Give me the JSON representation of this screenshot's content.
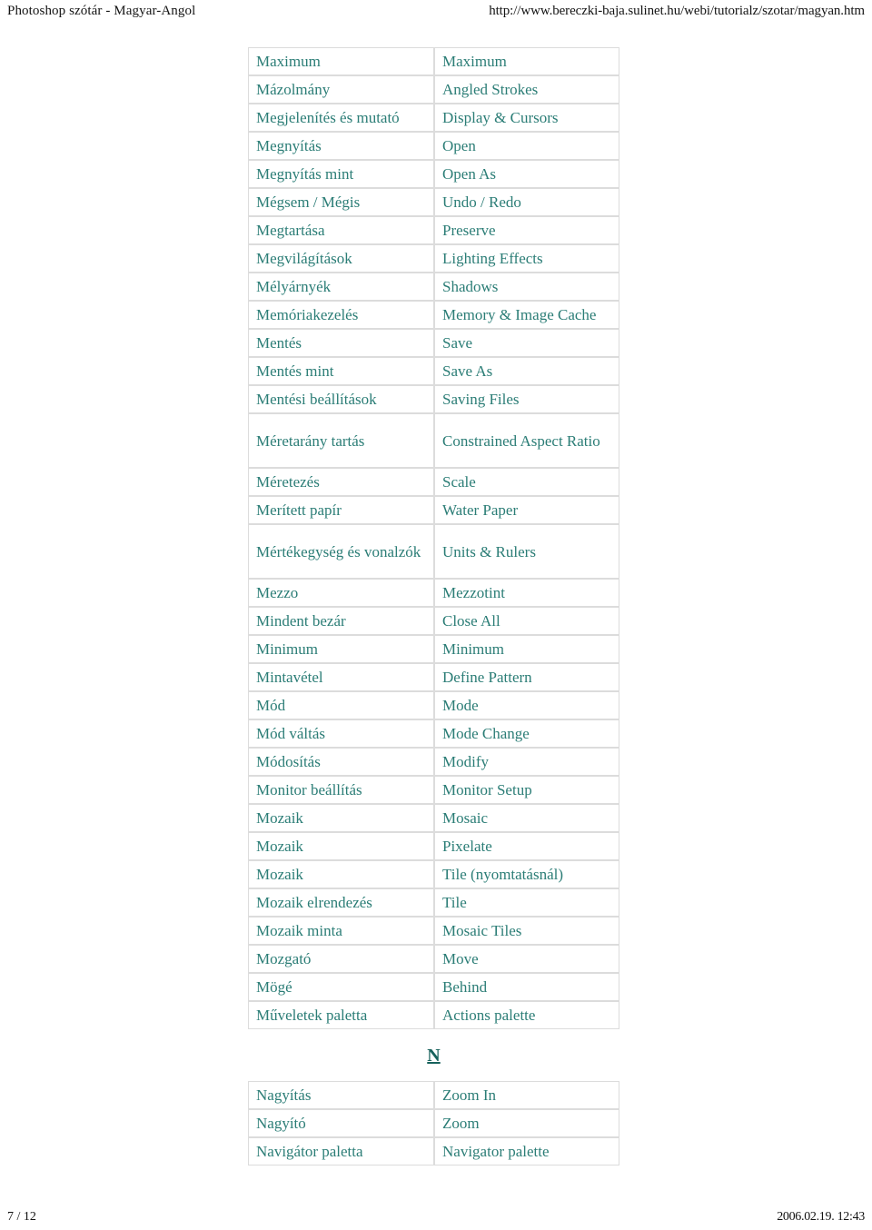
{
  "header": {
    "document_title": "Photoshop szótár - Magyar-Angol",
    "url": "http://www.bereczki-baja.sulinet.hu/webi/tutorialz/szotar/magyan.htm"
  },
  "footer": {
    "page_number": "7 / 12",
    "timestamp": "2006.02.19. 12:43"
  },
  "colors": {
    "text_teal": "#2b7d76",
    "heading_teal": "#17625c",
    "border_gray": "#dcdcdc",
    "header_text": "#141414",
    "background": "#ffffff"
  },
  "tables": [
    {
      "name": "entries-m",
      "rows": [
        {
          "hu": "Maximum",
          "en": "Maximum",
          "tall": false
        },
        {
          "hu": "Mázolmány",
          "en": "Angled Strokes",
          "tall": false
        },
        {
          "hu": "Megjelenítés és mutató",
          "en": "Display & Cursors",
          "tall": false
        },
        {
          "hu": "Megnyítás",
          "en": "Open",
          "tall": false
        },
        {
          "hu": "Megnyítás mint",
          "en": "Open As",
          "tall": false
        },
        {
          "hu": "Mégsem / Mégis",
          "en": "Undo / Redo",
          "tall": false
        },
        {
          "hu": "Megtartása",
          "en": "Preserve",
          "tall": false
        },
        {
          "hu": "Megvilágítások",
          "en": "Lighting Effects",
          "tall": false
        },
        {
          "hu": "Mélyárnyék",
          "en": "Shadows",
          "tall": false
        },
        {
          "hu": "Memóriakezelés",
          "en": "Memory & Image Cache",
          "tall": false
        },
        {
          "hu": "Mentés",
          "en": "Save",
          "tall": false
        },
        {
          "hu": "Mentés mint",
          "en": "Save As",
          "tall": false
        },
        {
          "hu": "Mentési beállítások",
          "en": "Saving Files",
          "tall": false
        },
        {
          "hu": "Méretarány tartás",
          "en": "Constrained Aspect Ratio",
          "tall": true
        },
        {
          "hu": "Méretezés",
          "en": "Scale",
          "tall": false
        },
        {
          "hu": "Merített papír",
          "en": " Water Paper",
          "tall": false
        },
        {
          "hu": "Mértékegység és vonalzók",
          "en": "Units & Rulers",
          "tall": true
        },
        {
          "hu": "Mezzo",
          "en": "Mezzotint",
          "tall": false
        },
        {
          "hu": "Mindent bezár",
          "en": "Close All",
          "tall": false
        },
        {
          "hu": "Minimum",
          "en": "Minimum",
          "tall": false
        },
        {
          "hu": "Mintavétel",
          "en": "Define Pattern",
          "tall": false
        },
        {
          "hu": "Mód",
          "en": "Mode",
          "tall": false
        },
        {
          "hu": "Mód váltás",
          "en": "Mode Change",
          "tall": false
        },
        {
          "hu": "Módosítás",
          "en": "Modify",
          "tall": false
        },
        {
          "hu": "Monitor beállítás",
          "en": "Monitor Setup",
          "tall": false
        },
        {
          "hu": "Mozaik",
          "en": "Mosaic",
          "tall": false
        },
        {
          "hu": "Mozaik",
          "en": "Pixelate",
          "tall": false
        },
        {
          "hu": "Mozaik",
          "en": "Tile (nyomtatásnál)",
          "tall": false
        },
        {
          "hu": "Mozaik elrendezés",
          "en": "Tile",
          "tall": false
        },
        {
          "hu": "Mozaik minta",
          "en": "Mosaic Tiles",
          "tall": false
        },
        {
          "hu": "Mozgató",
          "en": "Move",
          "tall": false
        },
        {
          "hu": "Mögé",
          "en": "Behind",
          "tall": false
        },
        {
          "hu": "Műveletek paletta",
          "en": "Actions palette",
          "tall": false
        }
      ]
    },
    {
      "name": "entries-n",
      "rows": [
        {
          "hu": "Nagyítás",
          "en": "Zoom In",
          "tall": false
        },
        {
          "hu": "Nagyító",
          "en": "Zoom",
          "tall": false
        },
        {
          "hu": "Navigátor paletta",
          "en": "Navigator palette",
          "tall": false
        }
      ]
    }
  ],
  "letter_divider": {
    "letter": "N"
  }
}
